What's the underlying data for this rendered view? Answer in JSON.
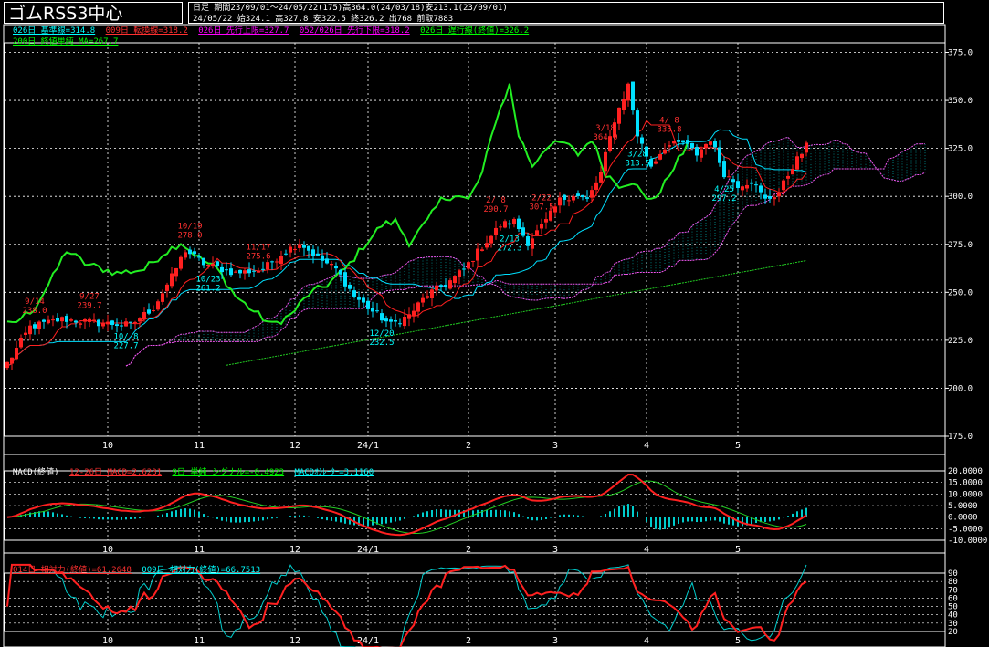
{
  "title": "ゴムRSS3中心",
  "info": {
    "line1": "日足  期間23/09/01～24/05/22(175)高364.0(24/03/18)安213.1(23/09/01)",
    "line2": "24/05/22     始324.1 高327.8 安322.5 終326.2 出768 前取7883"
  },
  "price_legend": {
    "items": [
      {
        "text": "026日 基準線=314.8",
        "color": "#00ffff"
      },
      {
        "text": "009日 転換線=318.2",
        "color": "#ff3030"
      },
      {
        "text": "026日 先行上限=327.7",
        "color": "#ff00ff"
      },
      {
        "text": "052/026日 先行下限=318.2",
        "color": "#ff00ff"
      },
      {
        "text": "026日 遅行線(終値)=326.2",
        "color": "#00ff00"
      }
    ],
    "ma": {
      "text": "200日 終値単純 MA=267.7",
      "color": "#00ff00"
    }
  },
  "macd_legend": {
    "items": [
      {
        "text": "MACD(終値)",
        "color": "#ffffff"
      },
      {
        "text": "12-26日 MACD=2.6231",
        "color": "#ff3030"
      },
      {
        "text": "9日 単純 シグナル=-0.4923",
        "color": "#00ff00"
      },
      {
        "text": "MACDｵｼﾚｰﾀｰ=3.1160",
        "color": "#00ffff"
      }
    ]
  },
  "rsi_legend": {
    "items": [
      {
        "text": "014日 相対力(終値)=61.2648",
        "color": "#ff3030"
      },
      {
        "text": "009日 相対力(終値)=66.7513",
        "color": "#00ffff"
      }
    ]
  },
  "colors": {
    "up": "#ff2020",
    "down": "#00e0ff",
    "kijun": "#00e0ff",
    "tenkan": "#ff2020",
    "chikou": "#22ee22",
    "ma": "#22cc22",
    "cloud": "#ee55ee",
    "grid": "#ffffff"
  },
  "chart_data": [
    {
      "type": "candlestick",
      "title": "ゴムRSS3中心",
      "x_labels": [
        "10",
        "11",
        "12",
        "24/1",
        "2",
        "3",
        "4",
        "5"
      ],
      "ylim": [
        175,
        380
      ],
      "yticks": [
        175.0,
        200.0,
        225.0,
        250.0,
        275.0,
        300.0,
        325.0,
        350.0,
        375.0
      ],
      "grid": true,
      "close_knots": [
        [
          0,
          213
        ],
        [
          5,
          232
        ],
        [
          12,
          236
        ],
        [
          20,
          234
        ],
        [
          27,
          233
        ],
        [
          32,
          242
        ],
        [
          36,
          258
        ],
        [
          39,
          272
        ],
        [
          43,
          265
        ],
        [
          50,
          260
        ],
        [
          56,
          262
        ],
        [
          60,
          270
        ],
        [
          64,
          276
        ],
        [
          68,
          268
        ],
        [
          72,
          262
        ],
        [
          76,
          248
        ],
        [
          80,
          240
        ],
        [
          84,
          233
        ],
        [
          88,
          238
        ],
        [
          92,
          249
        ],
        [
          96,
          254
        ],
        [
          100,
          262
        ],
        [
          104,
          274
        ],
        [
          108,
          285
        ],
        [
          111,
          287
        ],
        [
          114,
          276
        ],
        [
          118,
          287
        ],
        [
          121,
          298
        ],
        [
          124,
          301
        ],
        [
          127,
          298
        ],
        [
          130,
          312
        ],
        [
          133,
          340
        ],
        [
          136,
          358
        ],
        [
          138,
          332
        ],
        [
          141,
          316
        ],
        [
          144,
          326
        ],
        [
          148,
          328
        ],
        [
          151,
          322
        ],
        [
          154,
          330
        ],
        [
          157,
          312
        ],
        [
          160,
          306
        ],
        [
          163,
          308
        ],
        [
          166,
          298
        ],
        [
          169,
          302
        ],
        [
          172,
          316
        ],
        [
          175,
          326
        ]
      ],
      "price_annotations": [
        {
          "date": "9/14",
          "value": "238.0",
          "color": "#ff3030",
          "pos": "high"
        },
        {
          "date": "9/27",
          "value": "239.7",
          "color": "#ff3030",
          "pos": "high"
        },
        {
          "date": "10/ 8",
          "value": "227.7",
          "color": "#00ffff",
          "pos": "low"
        },
        {
          "date": "10/19",
          "value": "278.0",
          "color": "#ff3030",
          "pos": "high"
        },
        {
          "date": "10/23",
          "value": "261.2",
          "color": "#00ffff",
          "pos": "low"
        },
        {
          "date": "11/17",
          "value": "275.6",
          "color": "#ff3030",
          "pos": "high"
        },
        {
          "date": "12/20",
          "value": "232.5",
          "color": "#00ffff",
          "pos": "low"
        },
        {
          "date": "2/ 8",
          "value": "290.7",
          "color": "#ff3030",
          "pos": "high"
        },
        {
          "date": "2/13",
          "value": "272.3",
          "color": "#00ffff",
          "pos": "low"
        },
        {
          "date": "2/22",
          "value": "307.5",
          "color": "#ff3030",
          "pos": "high"
        },
        {
          "date": "3/18",
          "value": "364.0",
          "color": "#ff3030",
          "pos": "high"
        },
        {
          "date": "3/28",
          "value": "313.5",
          "color": "#00ffff",
          "pos": "low"
        },
        {
          "date": "4/ 8",
          "value": "335.8",
          "color": "#ff3030",
          "pos": "high"
        },
        {
          "date": "4/25",
          "value": "297.2",
          "color": "#00ffff",
          "pos": "low"
        }
      ]
    },
    {
      "type": "line",
      "title": "MACD(終値)",
      "yticks": [
        "20.0000",
        "15.0000",
        "10.0000",
        "5.0000",
        "0.0000",
        "-5.0000",
        "-10.0000"
      ],
      "ylim": [
        -10,
        20
      ]
    },
    {
      "type": "line",
      "title": "相対力",
      "yticks": [
        "90",
        "80",
        "70",
        "60",
        "50",
        "40",
        "30",
        "20"
      ],
      "ylim": [
        20,
        90
      ]
    }
  ]
}
